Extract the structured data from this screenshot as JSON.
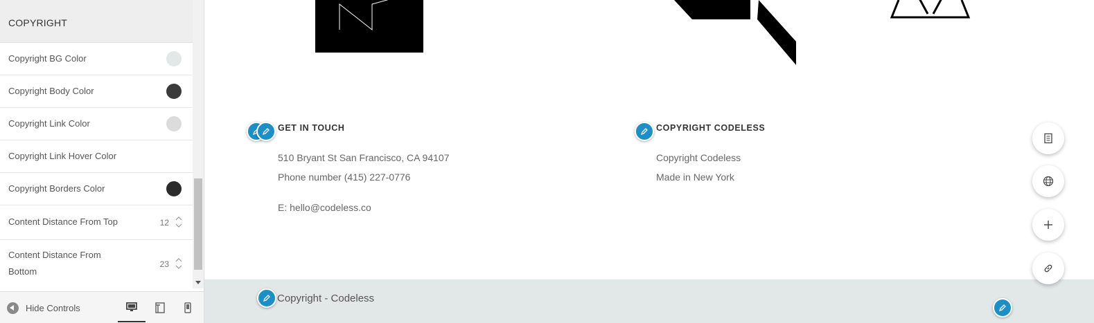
{
  "sidebar": {
    "section_title": "COPYRIGHT",
    "controls": [
      {
        "label": "Copyright BG Color",
        "type": "color",
        "color": "#e2e7e7"
      },
      {
        "label": "Copyright Body Color",
        "type": "color",
        "color": "#3b3b3b"
      },
      {
        "label": "Copyright Link Color",
        "type": "color",
        "color": "#dcdcdc"
      },
      {
        "label": "Copyright Link Hover Color",
        "type": "color",
        "color": ""
      },
      {
        "label": "Copyright Borders Color",
        "type": "color",
        "color": "#2b2b2b"
      },
      {
        "label": "Content Distance From Top",
        "type": "number",
        "value": "12"
      },
      {
        "label": "Content Distance From Bottom",
        "type": "number",
        "value": "23"
      }
    ],
    "footer": {
      "hide_controls_label": "Hide Controls",
      "devices": [
        "desktop-icon",
        "tablet-icon",
        "mobile-icon"
      ]
    }
  },
  "preview": {
    "get_in_touch": {
      "title": "GET IN TOUCH",
      "lines": [
        "510 Bryant St San Francisco, CA 94107",
        "Phone number (415) 227-0776",
        "E: hello@codeless.co"
      ]
    },
    "copyright_col": {
      "title": "COPYRIGHT CODELESS",
      "lines": [
        "Copyright Codeless",
        "Made in New York"
      ]
    },
    "copyright_bar": {
      "text": "Copyright - Codeless",
      "bg_color": "#e2e7e7"
    },
    "accent_color": "#1d8fc4",
    "floating_buttons": [
      "document-icon",
      "globe-icon",
      "plus-icon",
      "link-icon"
    ]
  }
}
